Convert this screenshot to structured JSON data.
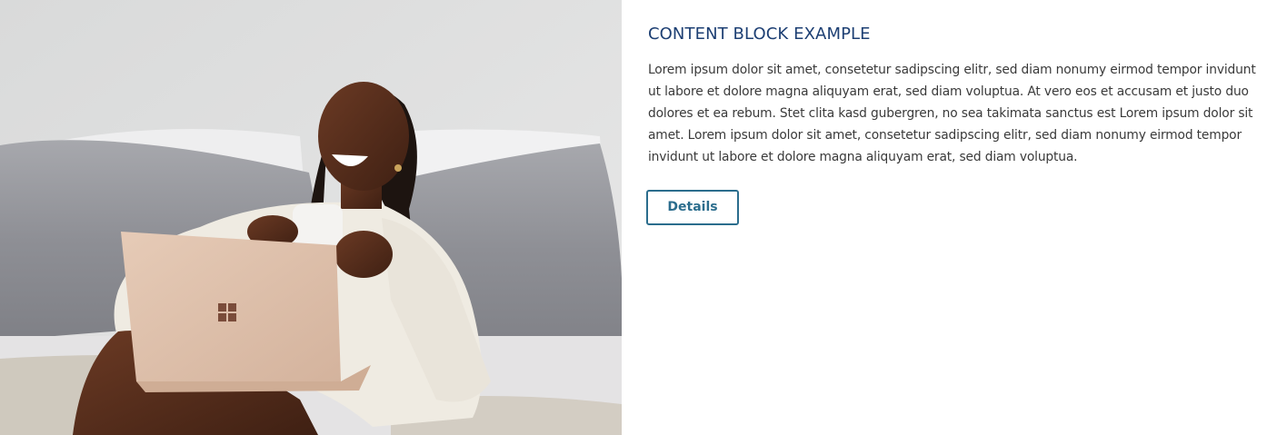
{
  "content_block": {
    "image": {
      "icon": "photo-woman-laughing-with-laptop-and-mug"
    },
    "title": "CONTENT BLOCK EXAMPLE",
    "body": "Lorem ipsum dolor sit amet, consetetur sadipscing elitr, sed diam nonumy eirmod tempor invidunt ut labore et dolore magna aliquyam erat, sed diam voluptua. At vero eos et accusam et justo duo dolores et ea rebum. Stet clita kasd gubergren, no sea takimata sanctus est Lorem ipsum dolor sit amet. Lorem ipsum dolor sit amet, consetetur sadipscing elitr, sed diam nonumy eirmod tempor invidunt ut labore et dolore magna aliquyam erat, sed diam voluptua.",
    "button_label": "Details"
  },
  "colors": {
    "title": "#1d3f73",
    "body_text": "#3a3a3a",
    "button": "#2b6d8d",
    "background": "#ffffff"
  }
}
